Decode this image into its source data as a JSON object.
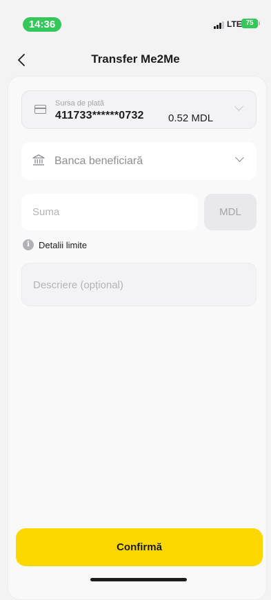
{
  "status_bar": {
    "time": "14:36",
    "network": "LTE",
    "battery": "75"
  },
  "header": {
    "back_icon": "chevron-left-icon",
    "title": "Transfer Me2Me"
  },
  "form": {
    "source": {
      "label": "Sursa de plată",
      "card_number": "411733******0732",
      "balance": "0.52 MDL",
      "icon": "credit-card-icon"
    },
    "bank": {
      "placeholder": "Banca beneficiară",
      "icon": "bank-icon"
    },
    "amount": {
      "placeholder": "Suma",
      "currency": "MDL"
    },
    "limits": {
      "label": "Detalii limite",
      "icon": "info-icon"
    },
    "description": {
      "placeholder": "Descriere (opțional)"
    }
  },
  "actions": {
    "confirm_label": "Confirmă"
  },
  "colors": {
    "accent": "#fdd800",
    "status_green": "#34c759"
  }
}
